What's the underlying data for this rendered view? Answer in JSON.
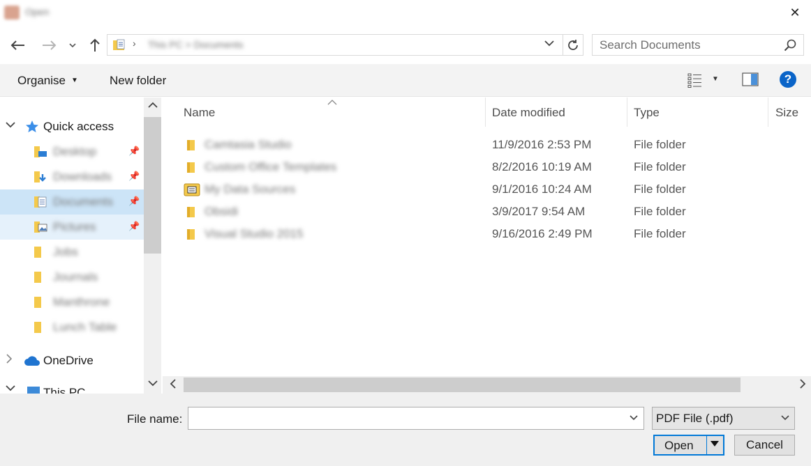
{
  "window": {
    "title": "Open",
    "close_label": "✕"
  },
  "navigation": {
    "address_path": "This PC  >  Documents",
    "search_placeholder": "Search Documents"
  },
  "toolbar": {
    "organise_label": "Organise",
    "new_folder_label": "New folder",
    "help_label": "?"
  },
  "nav_pane": {
    "quick_access_label": "Quick access",
    "quick_access_items": [
      {
        "label": "Desktop",
        "pinned": true,
        "icon": "desktop-folder-icon"
      },
      {
        "label": "Downloads",
        "pinned": true,
        "icon": "downloads-folder-icon"
      },
      {
        "label": "Documents",
        "pinned": true,
        "icon": "documents-folder-icon",
        "selected": true
      },
      {
        "label": "Pictures",
        "pinned": true,
        "icon": "pictures-folder-icon"
      },
      {
        "label": "Jobs",
        "pinned": false,
        "icon": "folder-icon"
      },
      {
        "label": "Journals",
        "pinned": false,
        "icon": "folder-icon"
      },
      {
        "label": "Manthrone",
        "pinned": false,
        "icon": "folder-icon"
      },
      {
        "label": "Lunch Table",
        "pinned": false,
        "icon": "folder-icon"
      }
    ],
    "onedrive_label": "OneDrive",
    "thispc_label": "This PC"
  },
  "file_list": {
    "columns": [
      "Name",
      "Date modified",
      "Type",
      "Size"
    ],
    "rows": [
      {
        "name": "Camtasia Studio",
        "date": "11/9/2016 2:53 PM",
        "type": "File folder",
        "icon": "folder-icon"
      },
      {
        "name": "Custom Office Templates",
        "date": "8/2/2016 10:19 AM",
        "type": "File folder",
        "icon": "folder-icon"
      },
      {
        "name": "My Data Sources",
        "date": "9/1/2016 10:24 AM",
        "type": "File folder",
        "icon": "data-sources-folder-icon"
      },
      {
        "name": "Obsidi",
        "date": "3/9/2017 9:54 AM",
        "type": "File folder",
        "icon": "folder-icon"
      },
      {
        "name": "Visual Studio 2015",
        "date": "9/16/2016 2:49 PM",
        "type": "File folder",
        "icon": "folder-icon"
      }
    ]
  },
  "bottom": {
    "filename_label": "File name:",
    "filename_value": "",
    "filetype_value": "PDF File (.pdf)",
    "open_label": "Open",
    "cancel_label": "Cancel"
  },
  "colors": {
    "selection": "#cce4f7",
    "hover": "#e5f1fb",
    "accent": "#0078d7",
    "help": "#0a64c8",
    "folder": "#f4c94b"
  }
}
